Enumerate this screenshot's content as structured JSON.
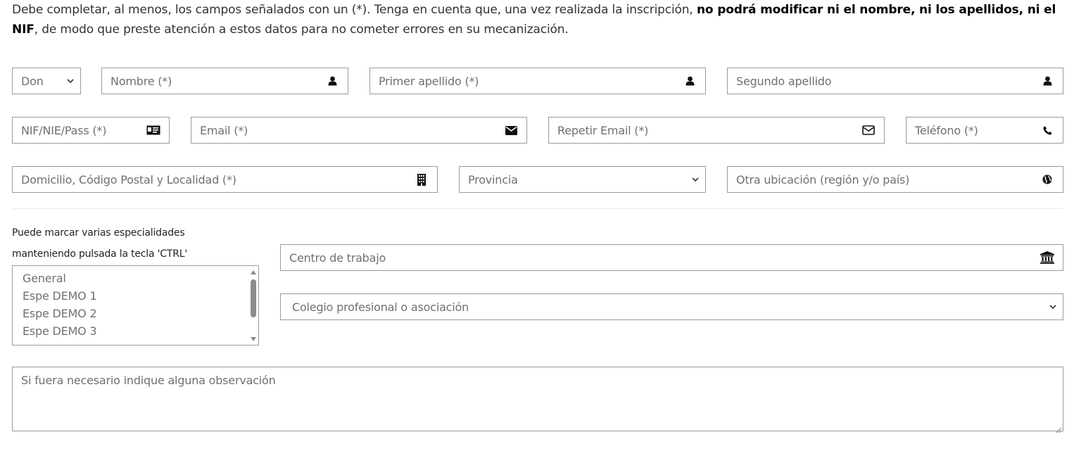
{
  "intro": {
    "part1": "Debe completar, al menos, los campos señalados con un (*). Tenga en cuenta que, una vez realizada la inscripción, ",
    "bold1": "no podrá modificar ni el nombre, ni los apellidos, ni el NIF",
    "part2": ", de modo que preste atención a estos datos para no cometer errores en su mecanización."
  },
  "form": {
    "tratamiento": {
      "selected": "Don"
    },
    "nombre": {
      "placeholder": "Nombre (*)",
      "icon": "user-icon"
    },
    "primer_apellido": {
      "placeholder": "Primer apellido (*)",
      "icon": "user-icon"
    },
    "segundo_apellido": {
      "placeholder": "Segundo apellido",
      "icon": "user-icon"
    },
    "nif": {
      "placeholder": "NIF/NIE/Pass (*)",
      "icon": "id-card-icon"
    },
    "email": {
      "placeholder": "Email (*)",
      "icon": "envelope-icon"
    },
    "repetir_email": {
      "placeholder": "Repetir Email (*)",
      "icon": "envelope-outline-icon"
    },
    "telefono": {
      "placeholder": "Teléfono (*)",
      "icon": "phone-icon"
    },
    "domicilio": {
      "placeholder": "Domicilio, Código Postal y Localidad (*)",
      "icon": "building-icon"
    },
    "provincia": {
      "selected": "Provincia"
    },
    "otra_ubicacion": {
      "placeholder": "Otra ubicación (región y/o país)",
      "icon": "globe-icon"
    },
    "especialidades": {
      "help_line1": "Puede marcar varias especialidades",
      "help_line2": "manteniendo pulsada la tecla 'CTRL'",
      "options": [
        "General",
        "Espe DEMO 1",
        "Espe DEMO 2",
        "Espe DEMO 3"
      ]
    },
    "centro_trabajo": {
      "placeholder": "Centro de trabajo",
      "icon": "institution-icon"
    },
    "colegio": {
      "selected": "Colegio profesional o asociación"
    },
    "observaciones": {
      "placeholder": "Si fuera necesario indique alguna observación"
    }
  },
  "colors": {
    "border": "#9a9a9a",
    "placeholder": "#707070",
    "text": "#333333"
  }
}
